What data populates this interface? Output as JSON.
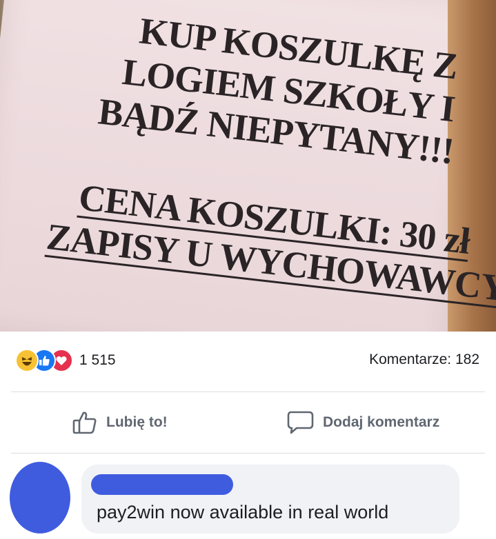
{
  "post": {
    "sign_lines": [
      "KUP KOSZULKĘ Z",
      "LOGIEM SZKOŁY I",
      "BĄDŹ NIEPYTANY!!!",
      "CENA KOSZULKI: 30 zł",
      "ZAPISY U WYCHOWAWCY"
    ]
  },
  "reactions": {
    "icons": [
      "haha-icon",
      "like-icon",
      "love-icon"
    ],
    "count": "1 515",
    "comments_label": "Komentarze: 182"
  },
  "actions": {
    "like_label": "Lubię to!",
    "comment_label": "Dodaj komentarz"
  },
  "comment": {
    "text": "pay2win now available in real world"
  },
  "colors": {
    "avatar": "#3f5cdf",
    "like_blue": "#1877f2",
    "love_red": "#e5314f",
    "haha_yellow": "#f7c134",
    "muted_text": "#606770"
  }
}
